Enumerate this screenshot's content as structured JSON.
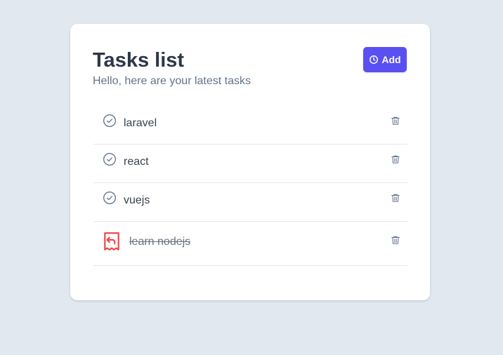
{
  "header": {
    "title": "Tasks list",
    "subtitle": "Hello, here are your latest tasks",
    "add_label": "Add"
  },
  "tasks": [
    {
      "label": "laravel",
      "done": false
    },
    {
      "label": "react",
      "done": false
    },
    {
      "label": "vuejs",
      "done": false
    },
    {
      "label": "learn nodejs",
      "done": true
    }
  ],
  "icons": {
    "add": "clock-icon",
    "pending": "check-circle-icon",
    "done": "undo-receipt-icon",
    "delete": "trash-icon"
  },
  "colors": {
    "background": "#e2e8f0",
    "card": "#ffffff",
    "accent": "#5a4ff0",
    "title": "#2d3748",
    "subtitle": "#64748b",
    "undo_icon": "#ef4444",
    "icon_gray": "#64748b"
  }
}
